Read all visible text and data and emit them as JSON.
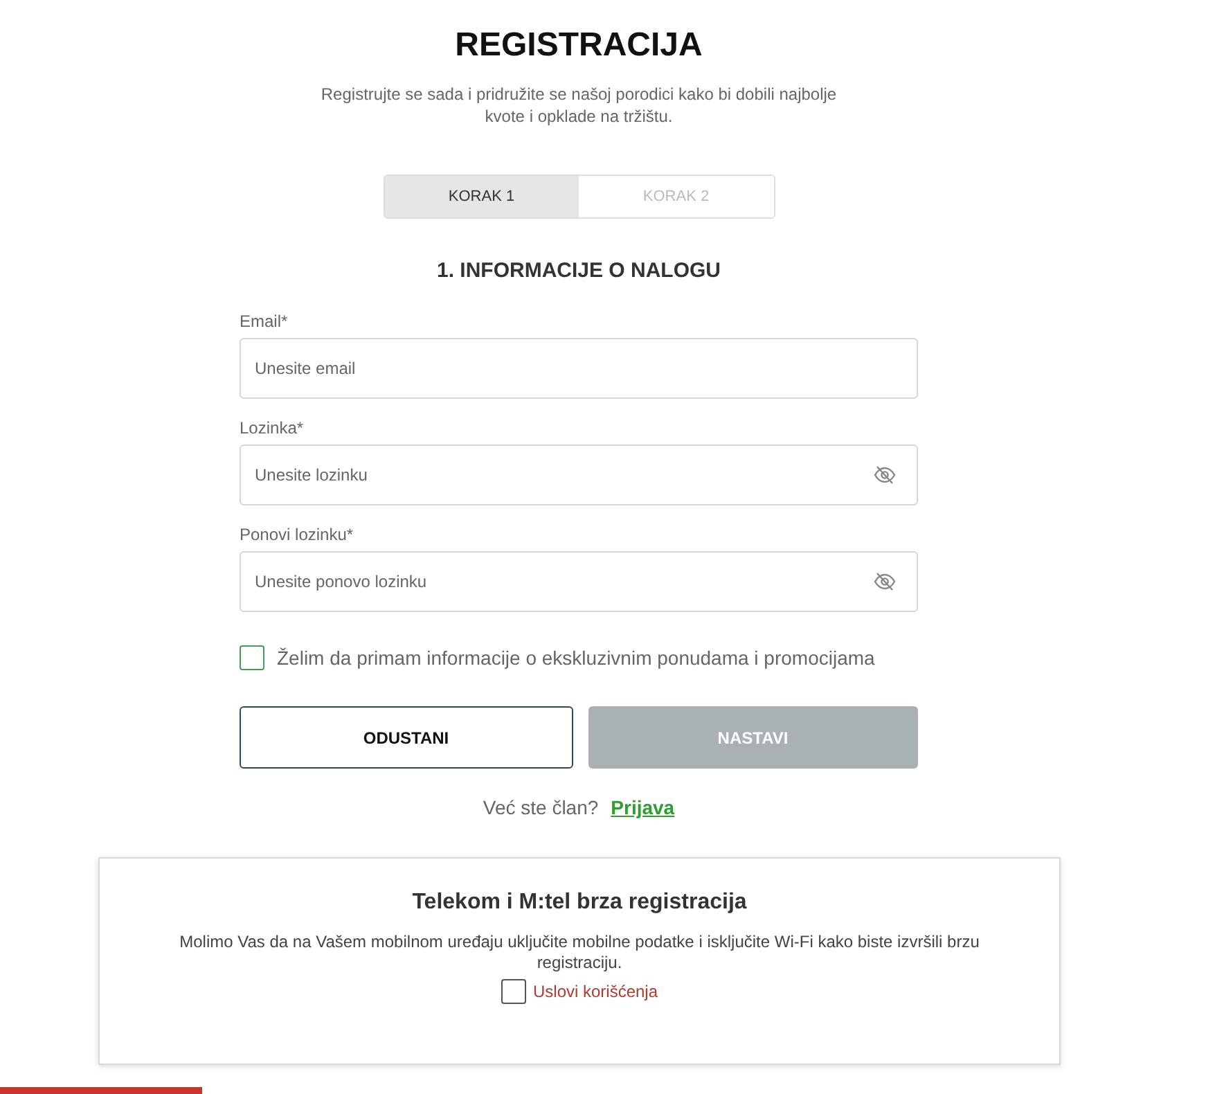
{
  "title": "REGISTRACIJA",
  "subtitle": "Registrujte se sada i pridružite se našoj porodici kako bi dobili najbolje kvote i opklade na tržištu.",
  "steps": [
    {
      "label": "KORAK 1",
      "selected": true
    },
    {
      "label": "KORAK 2",
      "selected": false
    }
  ],
  "section_title": "1. INFORMACIJE O NALOGU",
  "fields": [
    {
      "label": "Email*",
      "placeholder": "Unesite email",
      "kind": "email"
    },
    {
      "label": "Lozinka*",
      "placeholder": "Unesite lozinku",
      "kind": "password"
    },
    {
      "label": "Ponovi lozinku*",
      "placeholder": "Unesite ponovo lozinku",
      "kind": "password"
    }
  ],
  "newsletter": {
    "label": "Želim da primam informacije o ekskluzivnim ponudama i promocijama",
    "checked": false
  },
  "buttons": [
    {
      "label": "ODUSTANI",
      "disabled": false,
      "kind": "outline"
    },
    {
      "label": "NASTAVI",
      "disabled": true,
      "kind": "primary"
    }
  ],
  "login": {
    "text": "Već ste član?",
    "link": "Prijava"
  },
  "quick_registration": {
    "title": "Telekom i M:tel brza registracija",
    "text": "Molimo Vas da na Vašem mobilnom uređaju uključite mobilne podatke i isključite Wi-Fi kako biste izvršili brzu registraciju.",
    "terms": {
      "label": "Uslovi korišćenja",
      "checked": false
    }
  }
}
